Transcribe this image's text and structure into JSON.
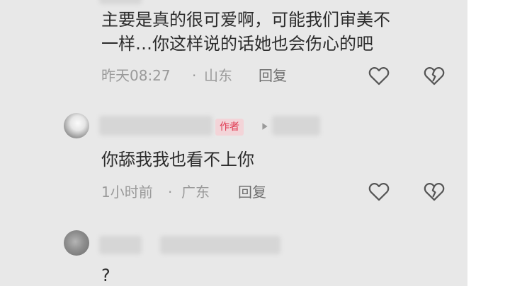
{
  "comments": [
    {
      "text_line1": "主要是真的很可爱啊，可能我们审美不",
      "text_line2": "一样…你这样说的话她也会伤心的吧",
      "time": "昨天08:27",
      "dot": "·",
      "location": "山东",
      "reply_label": "回复",
      "like_icon": "heart-outline-icon",
      "dislike_icon": "broken-heart-icon"
    },
    {
      "author_badge": "作者",
      "text": "你舔我我也看不上你",
      "time": "1小时前",
      "dot": "·",
      "location": "广东",
      "reply_label": "回复",
      "like_icon": "heart-outline-icon",
      "dislike_icon": "broken-heart-icon"
    },
    {
      "text": "?"
    }
  ],
  "colors": {
    "panel_bg": "#e8e8e8",
    "badge_text": "#e03c54",
    "meta_text": "#9a9a9a"
  }
}
